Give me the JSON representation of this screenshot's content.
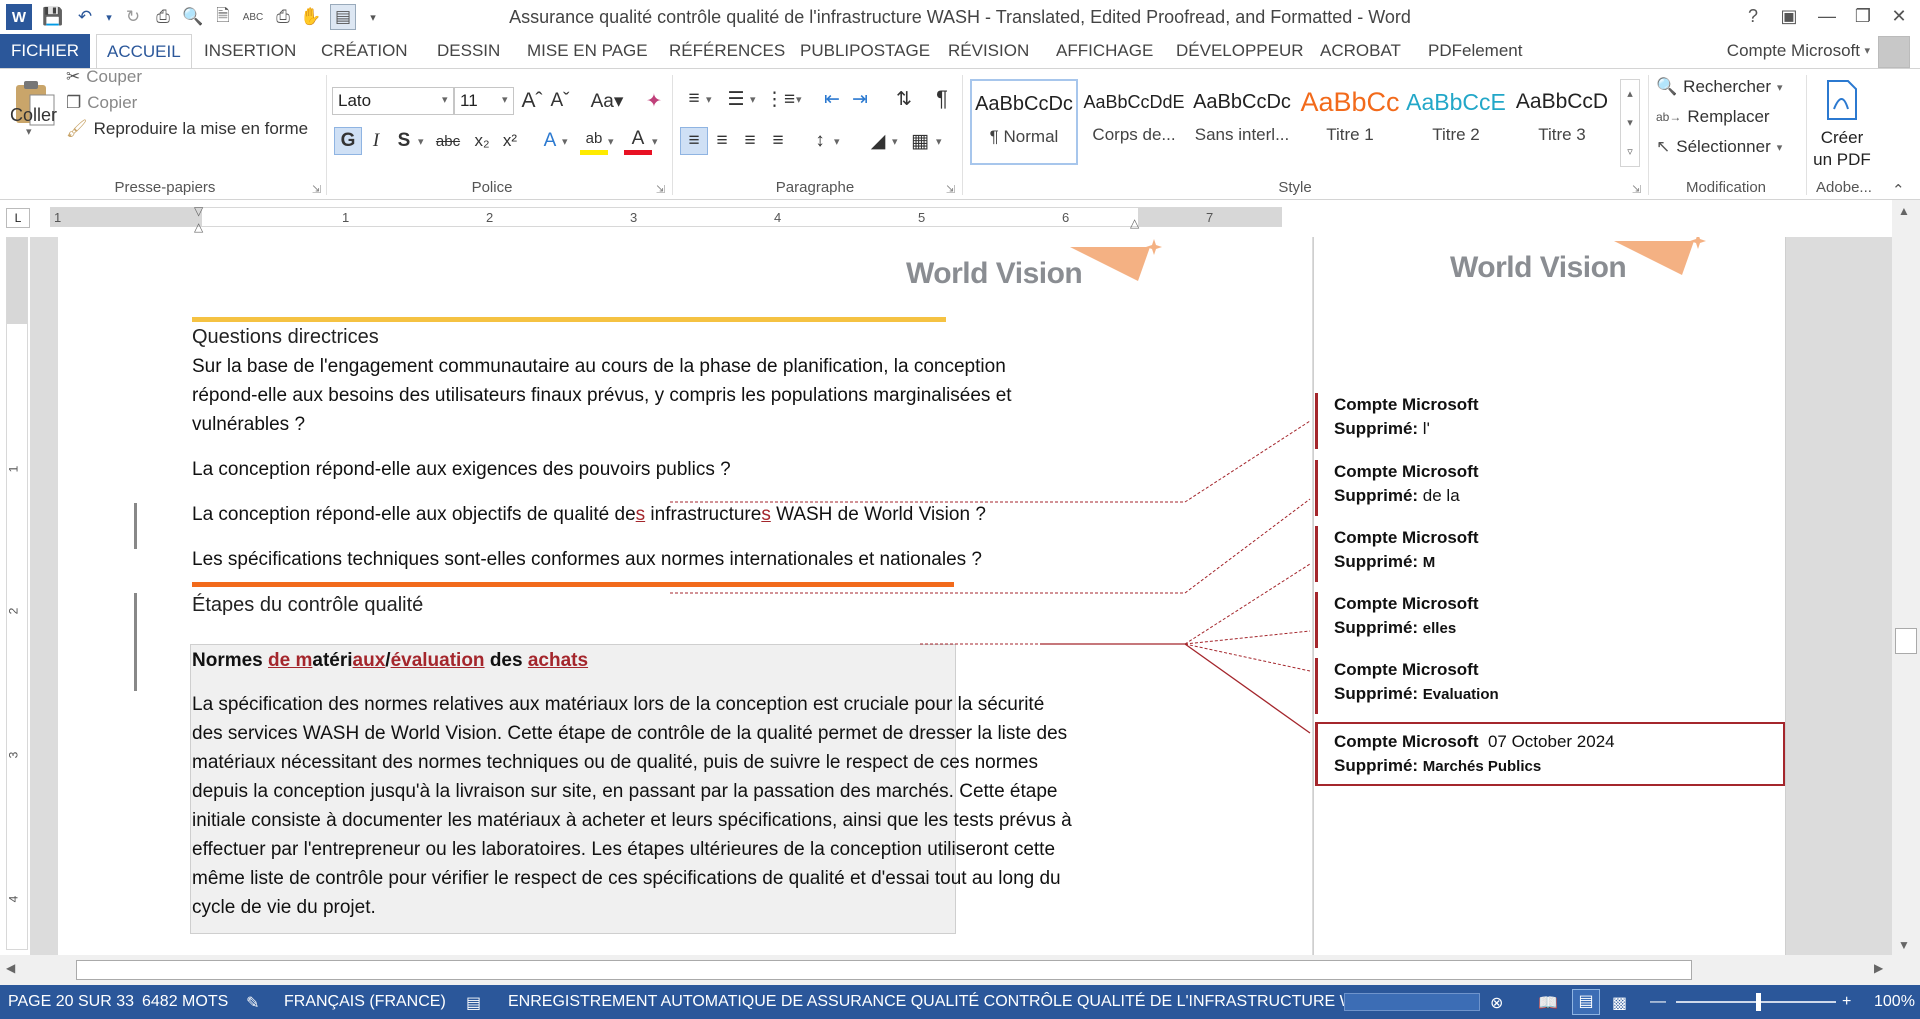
{
  "window": {
    "title": "Assurance qualité  contrôle qualité de l'infrastructure WASH - Translated, Edited Proofread, and Formatted - Word"
  },
  "tabs": [
    "FICHIER",
    "ACCUEIL",
    "INSERTION",
    "CRÉATION",
    "DESSIN",
    "MISE EN PAGE",
    "RÉFÉRENCES",
    "PUBLIPOSTAGE",
    "RÉVISION",
    "AFFICHAGE",
    "DÉVELOPPEUR",
    "ACROBAT",
    "PDFelement"
  ],
  "account": "Compte Microsoft",
  "ribbon": {
    "clipboard": {
      "paste": "Coller",
      "cut": "Couper",
      "copy": "Copier",
      "format_painter": "Reproduire la mise en forme",
      "label": "Presse-papiers"
    },
    "font": {
      "name": "Lato",
      "size": "11",
      "label": "Police"
    },
    "paragraph": {
      "label": "Paragraphe"
    },
    "styles": {
      "label": "Style",
      "items": [
        {
          "sample": "AaBbCcDc",
          "name": "¶ Normal"
        },
        {
          "sample": "AaBbCcDdE",
          "name": "Corps de..."
        },
        {
          "sample": "AaBbCcDc",
          "name": "Sans interl..."
        },
        {
          "sample": "AaBbCc",
          "name": "Titre 1"
        },
        {
          "sample": "AaBbCcE",
          "name": "Titre 2"
        },
        {
          "sample": "AaBbCcD",
          "name": "Titre 3"
        }
      ]
    },
    "editing": {
      "find": "Rechercher",
      "replace": "Remplacer",
      "select": "Sélectionner",
      "label": "Modification"
    },
    "adobe": {
      "create_pdf_1": "Créer",
      "create_pdf_2": "un PDF",
      "label": "Adobe..."
    }
  },
  "ruler": [
    "1",
    "1",
    "2",
    "3",
    "4",
    "5",
    "6",
    "7"
  ],
  "vruler": [
    "1",
    "2",
    "3",
    "4"
  ],
  "logo": "World Vision",
  "document": {
    "heading1": "Questions directrices",
    "p1_l1": "Sur la base de l'engagement communautaire au cours de la phase de planification, la conception",
    "p1_l2": "répond-elle aux besoins des utilisateurs finaux prévus, y compris les populations marginalisées et",
    "p1_l3": "vulnérables ?",
    "p2": "La conception répond-elle aux exigences des pouvoirs publics ?",
    "p3_a": "La conception répond-elle aux objectifs de qualité de",
    "p3_s1": "s",
    "p3_b": " infrastructure",
    "p3_s2": "s",
    "p3_c": " WASH de World Vision ?",
    "p4": "Les spécifications techniques sont-elles conformes aux normes internationales et nationales ?",
    "heading2": "Étapes du contrôle qualité",
    "box_title_a": "Normes ",
    "box_title_d1": "de m",
    "box_title_b": "atéri",
    "box_title_d2": "aux",
    "box_title_c": "/",
    "box_title_d3": "évaluation",
    "box_title_e": " des ",
    "box_title_d4": "achats",
    "box_lines": [
      "La spécification des normes relatives aux matériaux lors de la conception est cruciale pour la sécurité",
      "des services WASH de World Vision. Cette étape de contrôle de la qualité permet de dresser la liste des",
      "matériaux nécessitant des normes techniques ou de qualité, puis de suivre le respect de ces normes",
      "depuis la conception jusqu'à la livraison sur site, en passant par la passation des marchés. Cette étape",
      "initiale consiste à documenter les matériaux à acheter et leurs spécifications, ainsi que les tests prévus à",
      "effectuer par l'entrepreneur ou les laboratoires. Les étapes ultérieures de la conception utiliseront cette",
      "même liste de contrôle pour vérifier le respect de ces spécifications de qualité et d'essai tout au long du",
      "cycle de vie du projet."
    ]
  },
  "comments": [
    {
      "author": "Compte Microsoft",
      "label": "Supprimé:",
      "text": "l'",
      "date": ""
    },
    {
      "author": "Compte Microsoft",
      "label": "Supprimé:",
      "text": " de la",
      "date": ""
    },
    {
      "author": "Compte Microsoft",
      "label": "Supprimé:",
      "text": "M",
      "date": ""
    },
    {
      "author": "Compte Microsoft",
      "label": "Supprimé:",
      "text": "elles",
      "date": ""
    },
    {
      "author": "Compte Microsoft",
      "label": "Supprimé:",
      "text": "Evaluation",
      "date": ""
    },
    {
      "author": "Compte Microsoft",
      "label": "Supprimé:",
      "text": "Marchés Publics",
      "date": "07 October 2024"
    }
  ],
  "status": {
    "page": "PAGE 20 SUR 33",
    "words": "6482 MOTS",
    "language": "FRANÇAIS (FRANCE)",
    "autosave": "ENREGISTREMENT AUTOMATIQUE DE ASSURANCE QUALITÉ  CONTRÔLE QUALITÉ DE L'INFRASTRUCTURE WASH - T...",
    "zoom": "100%"
  },
  "colors": {
    "accent": "#2b579a",
    "revision": "#a4262c",
    "yellow_rule": "#f5c242",
    "orange_rule": "#f26a1b"
  }
}
